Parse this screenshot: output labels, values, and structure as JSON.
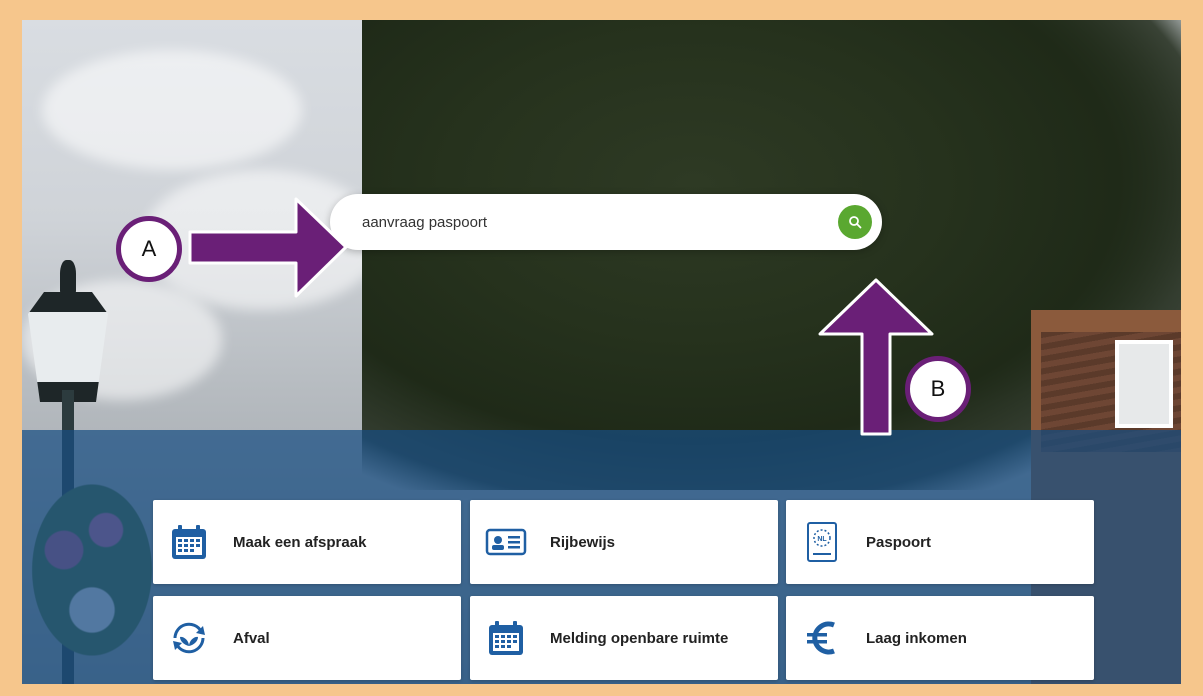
{
  "search": {
    "value": "aanvraag paspoort",
    "button_icon": "search-icon",
    "button_color": "#5aa830"
  },
  "tiles": [
    {
      "label": "Maak een afspraak",
      "icon": "calendar-icon"
    },
    {
      "label": "Rijbewijs",
      "icon": "id-card-icon"
    },
    {
      "label": "Paspoort",
      "icon": "passport-icon"
    },
    {
      "label": "Afval",
      "icon": "recycle-icon"
    },
    {
      "label": "Melding openbare ruimte",
      "icon": "calendar-icon"
    },
    {
      "label": "Laag inkomen",
      "icon": "euro-icon"
    }
  ],
  "annotations": {
    "a": "A",
    "b": "B"
  },
  "colors": {
    "frame": "#f6c68c",
    "arrow": "#6a1f77",
    "band": "#184e82",
    "icon_blue": "#1f5fa3"
  }
}
